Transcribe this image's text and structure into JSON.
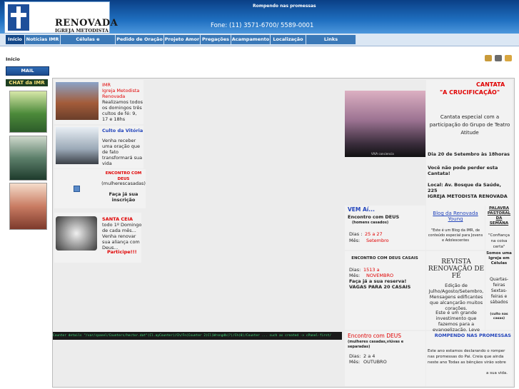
{
  "header": {
    "logo_name": "RENOVADA",
    "logo_sub": "IGREJA METODISTA",
    "tagline": "Rompendo nas promessas",
    "phone": "Fone: (11) 3571-6700/ 5589-0001"
  },
  "menu": {
    "items": [
      {
        "label": "Início"
      },
      {
        "label": "Notícias IMR"
      },
      {
        "label": "Células e Ministérios"
      },
      {
        "label": "Pedido de Oração"
      },
      {
        "label": "Projeto Amor"
      },
      {
        "label": "Pregações"
      },
      {
        "label": "Acampamento"
      },
      {
        "label": "Localização"
      },
      {
        "label": "Links Interessantes"
      }
    ]
  },
  "breadcrumb": "Início",
  "sidebar": {
    "mail_label": "MAIL",
    "chat_label": "CHAT da IMR"
  },
  "colors": {
    "header": "#1f6fc0",
    "menu": "#3b79b8",
    "accent_red": "#e00000"
  },
  "items": {
    "imr": {
      "title": "IMR",
      "line1": "Igreja Metodista",
      "line2": "Renovada",
      "text": "Realizamos todos os domingos três cultos de fé: 9, 17 e 18hs"
    },
    "culto": {
      "title": "Culto da Vitória",
      "text": "Venha receber uma oração que de fato transformará sua vida"
    },
    "encontro1": {
      "title": "ENCONTRO COM DEUS",
      "sub": "(mulherescasadas)",
      "cta": "Faça já sua inscrição"
    },
    "santa": {
      "title": "SANTA CEIA",
      "text": "todo 1º Domingo de cada mês... Venha renovar sua aliança com Deus...",
      "cta": "Participe!!!"
    }
  },
  "cantata": {
    "title1": "CANTATA",
    "title2": "\"A CRUCIFICAÇÃO\"",
    "text": "Cantata especial com a participação do Grupo de Teatro Atitude",
    "date": "Dia 20 de Setembro às 18horas",
    "invite": "Você não pode perder esta Cantata!",
    "place": "Local: Av. Bosque da Saúde, 225",
    "church": "IGREJA METODISTA RENOVADA",
    "caption": "VIVA conciencia"
  },
  "vemai": {
    "title": "VEM Aí...",
    "sub": "Encontro com DEUS",
    "note": "(homens casados)",
    "dias_label": "Dias :",
    "dias": "25 a 27",
    "mes_label": "Mês:",
    "mes": "Setembro"
  },
  "blog": {
    "title": "Blog da Renovada Young",
    "text": "\"Este é um Blog da IMR, de conteúdo especial para Jovens e Adolescentes"
  },
  "palavra": {
    "title": "PALAVRA PASTORAL DA SEMANA",
    "text": "\"Confiança na coisa certa\""
  },
  "encontro2": {
    "title": "ENCONTRO COM DEUS CASAIS",
    "dias_label": "Dias:",
    "dias": "1513 a",
    "mes_label": "Mês:",
    "mes": "NOVEMBRO",
    "cta": "Faça já a sua reserva!",
    "vagas": "VAGAS PARA 20 CASAIS"
  },
  "revista": {
    "title": "REVISTA RENOVAÇÃO DE FÉ",
    "text": "Edição de Julho/Agosto/Setembro, Mensagens edificantes que alcançarão muitos corações.",
    "text2": "Este é um grande investimento que fazemos para a evangelização. Leve vários exemplares."
  },
  "celulas": {
    "text": "Somos uma Igreja em Células",
    "days": "Quartas-feiras Sextas-feiras e sábados",
    "note": "(culto nas casas)"
  },
  "encontro3": {
    "title": "Encontro com DEUS",
    "sub": "(mulheres casadas,viúvas e separadas)",
    "dias_label": "Dias:",
    "dias": "2 a 4",
    "mes_label": "Mês:",
    "mes": "OUTUBRO"
  },
  "rompendo": {
    "title": "ROMPENDO NAS PROMESSAS",
    "text": "Este ano estamos declarando o romper nas promessas do Pai. Creia que ainda neste ano Todas as bênçãos virão sobre",
    "tail": "a sua vida."
  },
  "console_text": "Counter details \"/var/cpanel/Counters/hector.dat\"(Cl.ayCounter)/Ch/Fn(Counter 2)Cl(Wrongdb(?)/Ch(0)/Counter ... such as created -> cPanel-first/"
}
